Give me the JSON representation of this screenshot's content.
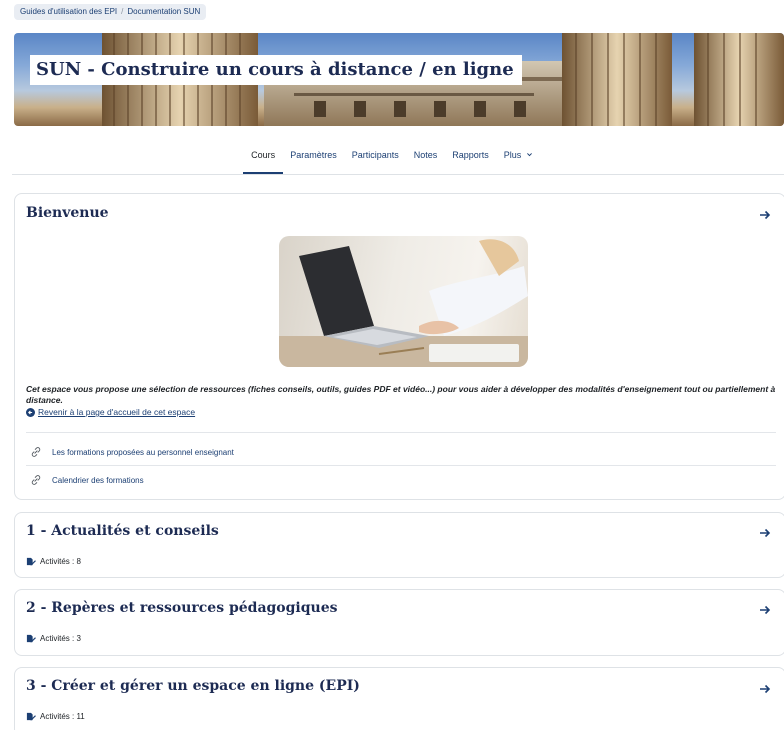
{
  "breadcrumb": {
    "items": [
      "Guides d'utilisation des EPI",
      "Documentation SUN"
    ],
    "separator": "/"
  },
  "course": {
    "title": "SUN - Construire un cours à distance / en ligne"
  },
  "nav": {
    "tabs": [
      {
        "label": "Cours",
        "active": true
      },
      {
        "label": "Paramètres"
      },
      {
        "label": "Participants"
      },
      {
        "label": "Notes"
      },
      {
        "label": "Rapports"
      },
      {
        "label": "Plus"
      }
    ]
  },
  "welcome": {
    "title": "Bienvenue",
    "description": "Cet espace vous propose une sélection de ressources (fiches conseils, outils, guides PDF et vidéo...) pour vous aider à développer des modalités d'enseignement tout ou partiellement à distance.",
    "home_link": "Revenir à la page d'accueil de cet espace",
    "resources": [
      "Les formations proposées au personnel enseignant",
      "Calendrier des formations"
    ]
  },
  "sections": [
    {
      "title": "1 - Actualités et conseils",
      "activities": "Activités : 8"
    },
    {
      "title": "2 - Repères et ressources pédagogiques",
      "activities": "Activités : 3"
    },
    {
      "title": "3 - Créer et gérer un espace en ligne (EPI)",
      "activities": "Activités : 11"
    }
  ],
  "colors": {
    "link": "#1c3f73",
    "heading": "#1d2b53",
    "border": "#dee2e6"
  },
  "icons": {
    "section_arrow": "arrow-right-icon",
    "resource": "link-icon",
    "activities": "activity-icon",
    "home": "arrow-circle-left-icon",
    "more": "chevron-down-icon"
  }
}
